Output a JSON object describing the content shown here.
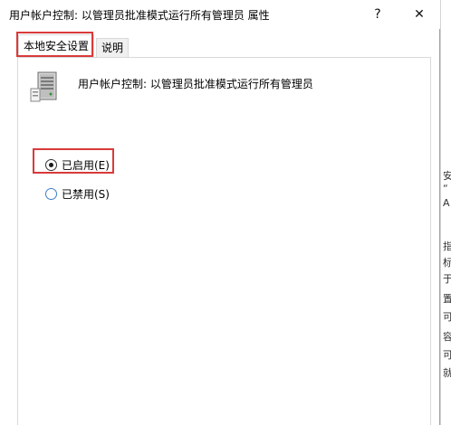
{
  "window": {
    "title": "用户帐户控制: 以管理员批准模式运行所有管理员 属性",
    "help_glyph": "?",
    "close_glyph": "✕"
  },
  "tabs": [
    {
      "label": "本地安全设置",
      "selected": true
    },
    {
      "label": "说明",
      "selected": false
    }
  ],
  "policy": {
    "icon": "server-computer-icon",
    "title": "用户帐户控制: 以管理员批准模式运行所有管理员"
  },
  "options": [
    {
      "label": "已启用(E)",
      "checked": true
    },
    {
      "label": "已禁用(S)",
      "checked": false
    }
  ],
  "annotations": {
    "highlight_color": "#d93a3a"
  },
  "background_fragments": [
    "安",
    "“",
    "就",
    "A",
    "指",
    "标",
    "于",
    "置",
    "可",
    "容",
    "可"
  ]
}
